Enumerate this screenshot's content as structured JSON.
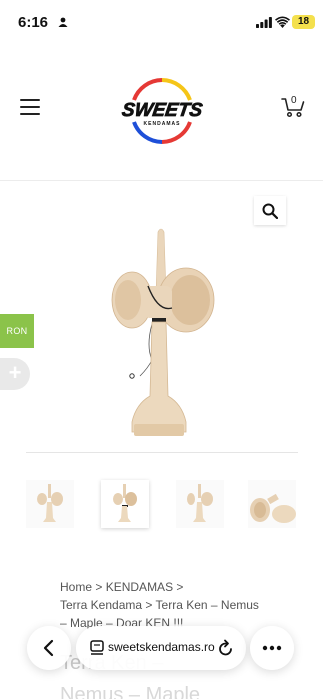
{
  "status_bar": {
    "time": "6:16",
    "battery": "18"
  },
  "header": {
    "logo_text": "SWEETS",
    "logo_subtext": "KENDAMAS",
    "cart_count": "0"
  },
  "side": {
    "currency_label": "RON",
    "add_label": "+"
  },
  "breadcrumb": {
    "items": [
      "Home",
      "KENDAMAS",
      "Terra Kendama",
      "Terra Ken – Nemus – Maple – Doar KEN !!!"
    ],
    "sep": ">"
  },
  "product": {
    "title_line1": "Terra Ken –",
    "title_line2": "Nemus – Maple"
  },
  "browser": {
    "url": "sweetskendamas.ro"
  },
  "colors": {
    "accent": "#8bc34a",
    "logo_red": "#e53935",
    "logo_blue": "#1e4fd8",
    "logo_yellow": "#f5c518"
  }
}
